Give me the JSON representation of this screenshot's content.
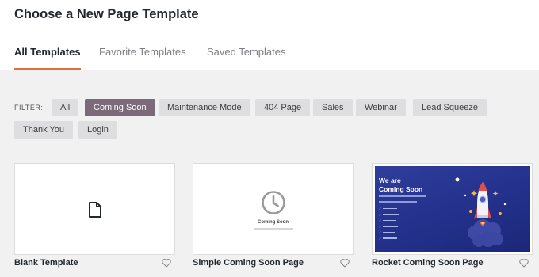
{
  "header": {
    "title": "Choose a New Page Template"
  },
  "tabs": [
    {
      "label": "All Templates",
      "active": true
    },
    {
      "label": "Favorite Templates",
      "active": false
    },
    {
      "label": "Saved Templates",
      "active": false
    }
  ],
  "filter": {
    "label": "FILTER:",
    "options": [
      "All",
      "Coming Soon",
      "Maintenance Mode",
      "404 Page",
      "Sales",
      "Webinar",
      "Lead Squeeze",
      "Thank You",
      "Login"
    ],
    "selected": "Coming Soon"
  },
  "templates": [
    {
      "name": "Blank Template",
      "icon": "file-icon"
    },
    {
      "name": "Simple Coming Soon Page",
      "preview_text": "Coming Soon",
      "icon": "clock-icon"
    },
    {
      "name": "Rocket Coming Soon Page",
      "preview_title_line1": "We are",
      "preview_title_line2": "Coming Soon",
      "icon": "rocket-icon"
    }
  ],
  "colors": {
    "accent": "#df6d3d",
    "active_pill": "#7b6b78",
    "pill": "#dedddf",
    "rocket_bg": "#22308a"
  }
}
